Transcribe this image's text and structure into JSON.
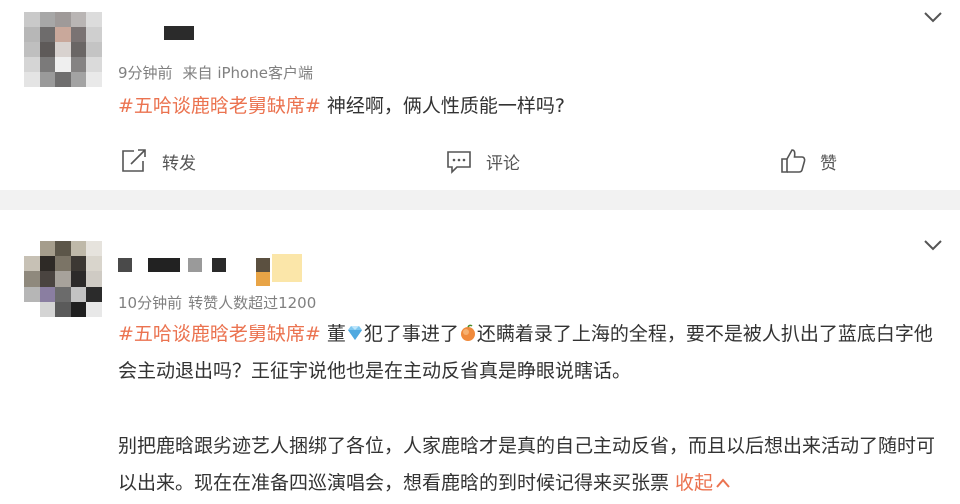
{
  "posts": [
    {
      "meta_time": "9分钟前",
      "meta_source": "来自 iPhone客户端",
      "hashtag": "#五哈谈鹿晗老舅缺席#",
      "text": " 神经啊，俩人性质能一样吗?",
      "actions": {
        "repost_label": "转发",
        "comment_label": "评论",
        "like_label": "赞"
      }
    },
    {
      "meta_time": "10分钟前",
      "meta_extra": "转赞人数超过1200",
      "hashtag": "#五哈谈鹿晗老舅缺席#",
      "text_part1": " 董",
      "text_part2": "犯了事进了",
      "text_part3": "还瞒着录了上海的全程，要不是被人扒出了蓝底白字他会主动退出吗？王征宇说他也是在主动反省真是睁眼说瞎话。",
      "text_para2": "别把鹿晗跟劣迹艺人捆绑了各位，人家鹿晗才是真的自己主动反省，而且以后想出来活动了随时可以出来。现在在准备四巡演唱会，想看鹿晗的到时候记得来买张票 ",
      "collapse_label": "收起"
    }
  ],
  "icons": {
    "chevron": "chevron-down-icon",
    "repost": "repost-icon",
    "comment": "comment-icon",
    "like": "like-icon",
    "diamond_emoji": "gem-emoji",
    "peach_emoji": "peach-emoji"
  },
  "colors": {
    "accent": "#eb7350",
    "meta": "#808080",
    "divider": "#f2f2f2"
  }
}
